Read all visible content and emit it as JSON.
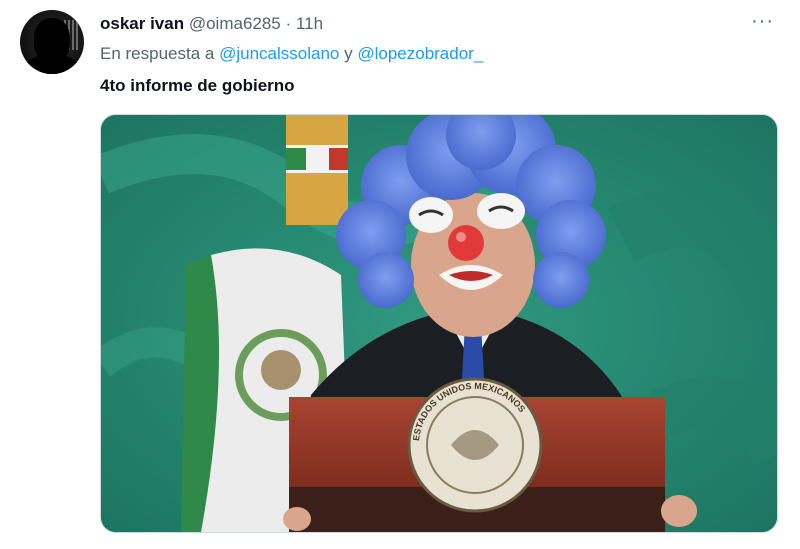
{
  "tweet": {
    "display_name": "oskar ivan",
    "handle": "@oima6285",
    "separator": "·",
    "time": "11h",
    "reply_prefix": "En respuesta a",
    "reply_mention_1": "@juncalssolano",
    "reply_conjunction": "y",
    "reply_mention_2": "@lopezobrador_",
    "text": "4to informe de gobierno",
    "more_icon": "more-horizontal-icon"
  },
  "media": {
    "description_icon": "photo",
    "podium_seal_text": "ESTADOS UNIDOS MEXICANOS"
  },
  "colors": {
    "link": "#1d9bf0",
    "secondary_text": "#536471",
    "background_green": "#2a8a72",
    "wig_blue": "#5b7fe0",
    "podium": "#9b3a2a"
  }
}
